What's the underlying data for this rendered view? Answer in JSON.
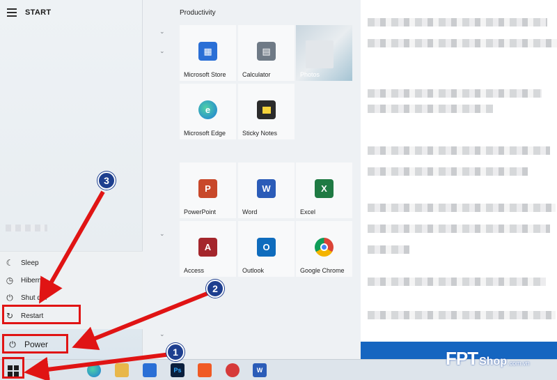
{
  "start_menu": {
    "title": "START",
    "group_title": "Productivity"
  },
  "tiles": [
    {
      "id": "store",
      "label": "Microsoft Store"
    },
    {
      "id": "calc",
      "label": "Calculator"
    },
    {
      "id": "photos",
      "label": "Photos"
    },
    {
      "id": "edge",
      "label": "Microsoft Edge"
    },
    {
      "id": "sticky",
      "label": "Sticky Notes"
    },
    {
      "id": "ppt",
      "label": "PowerPoint"
    },
    {
      "id": "word",
      "label": "Word"
    },
    {
      "id": "excel",
      "label": "Excel"
    },
    {
      "id": "access",
      "label": "Access"
    },
    {
      "id": "outlook",
      "label": "Outlook"
    },
    {
      "id": "chrome",
      "label": "Google Chrome"
    }
  ],
  "power_menu": {
    "sleep": "Sleep",
    "hibernate": "Hibern",
    "shutdown": "Shut d   n",
    "restart": "Restart",
    "power": "Power"
  },
  "annotations": {
    "step1": "1",
    "step2": "2",
    "step3": "3"
  },
  "brand": {
    "name": "FPT",
    "suffix": "Shop",
    "domain": ".com.vn"
  },
  "colors": {
    "callout": "#e01414",
    "badge": "#1e3f8f",
    "accent": "#1565c0"
  }
}
